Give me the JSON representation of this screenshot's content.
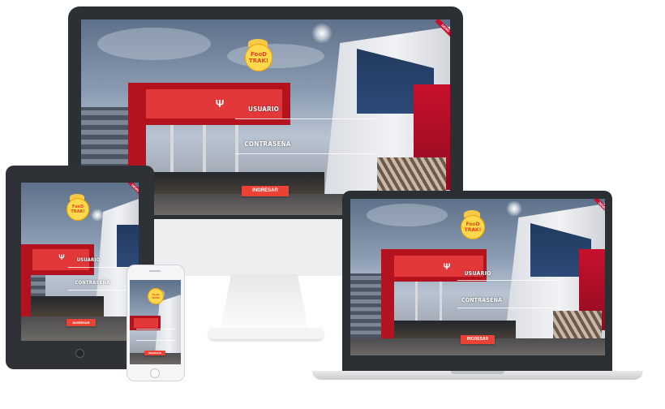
{
  "app": {
    "logo_text": "FooD TRAK!",
    "user_label": "USUARIO",
    "password_label": "CONTRASEÑA",
    "login_button": "INGRESAR",
    "corner_ribbon": "DEMO"
  },
  "colors": {
    "accent_red": "#c8102e",
    "button_red": "#ea4335",
    "logo_yellow": "#ffd84d",
    "device_dark": "#2b3035"
  },
  "icons": {
    "university_logo": "upc-flame-icon",
    "home_button": "home-button-icon"
  }
}
